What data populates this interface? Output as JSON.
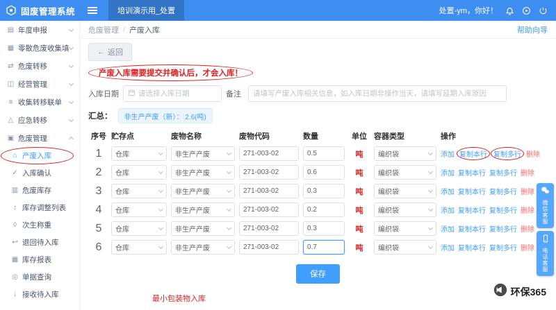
{
  "header": {
    "logo_icon": "cube-logo-icon",
    "app_title": "固废管理系统",
    "active_tab": "培训演示用_处置",
    "greeting": "处置-ym，你好！",
    "icons": [
      "bell-icon",
      "play-circle-icon",
      "power-icon"
    ]
  },
  "sidebar": {
    "items": [
      {
        "label": "年度申报",
        "icon": "calendar-icon",
        "type": "top"
      },
      {
        "label": "零散危废收集填报",
        "icon": "clipboard-icon",
        "type": "top"
      },
      {
        "label": "危废转移",
        "icon": "transfer-icon",
        "type": "top"
      },
      {
        "label": "经营管理",
        "icon": "briefcase-icon",
        "type": "top"
      },
      {
        "label": "收集转移联单",
        "icon": "list-icon",
        "type": "top"
      },
      {
        "label": "应急转移",
        "icon": "alert-icon",
        "type": "top"
      },
      {
        "label": "危废管理",
        "icon": "box-icon",
        "type": "top",
        "expanded": true
      },
      {
        "label": "产废入库",
        "icon": "warehouse-icon",
        "type": "sub",
        "active": true,
        "circled": true
      },
      {
        "label": "入库确认",
        "icon": "check-icon",
        "type": "sub"
      },
      {
        "label": "危废库存",
        "icon": "inventory-icon",
        "type": "sub"
      },
      {
        "label": "库存调整列表",
        "icon": "adjust-icon",
        "type": "sub"
      },
      {
        "label": "次生称重",
        "icon": "scale-icon",
        "type": "sub"
      },
      {
        "label": "退回待入库",
        "icon": "return-icon",
        "type": "sub"
      },
      {
        "label": "库存报表",
        "icon": "report-icon",
        "type": "sub"
      },
      {
        "label": "单据查询",
        "icon": "search-icon",
        "type": "sub"
      },
      {
        "label": "接收待入库",
        "icon": "receive-icon",
        "type": "sub"
      }
    ]
  },
  "breadcrumb": {
    "items": [
      "危废管理",
      "产废入库"
    ],
    "separator": "/",
    "help_link": "帮助向导"
  },
  "toolbar": {
    "back_icon": "←",
    "back_label": "返回"
  },
  "notice": "产废入库需要提交并确认后，才会入库！",
  "form": {
    "date_label": "入库日期",
    "date_placeholder": "请选择入库日期",
    "remark_label": "备注",
    "remark_placeholder": "请填写产废入库相关信息，如入库日期非操作当天，请填写延期入库原因"
  },
  "summary": {
    "label": "汇总：",
    "badge": "非生产产废（新）： 2.6(吨)"
  },
  "table": {
    "headers": [
      "序号",
      "贮存点",
      "废物名称",
      "废物代码",
      "数量",
      "单位",
      "容器类型",
      "操作"
    ],
    "op_labels": [
      "添加",
      "复制本行",
      "复制多行",
      "删除"
    ],
    "rows": [
      {
        "no": "1",
        "storage": "仓库",
        "waste_name": "非生产产废",
        "code": "271-003-02",
        "qty": "0.5",
        "unit": "吨",
        "container": "编织袋",
        "circle_ops": true
      },
      {
        "no": "2",
        "storage": "仓库",
        "waste_name": "非生产产废",
        "code": "271-003-02",
        "qty": "0.6",
        "unit": "吨",
        "container": "编织袋"
      },
      {
        "no": "3",
        "storage": "仓库",
        "waste_name": "非生产产废",
        "code": "271-003-02",
        "qty": "0.3",
        "unit": "吨",
        "container": "编织袋"
      },
      {
        "no": "4",
        "storage": "仓库",
        "waste_name": "非生产产废",
        "code": "271-003-02",
        "qty": "0.2",
        "unit": "吨",
        "container": "编织袋"
      },
      {
        "no": "5",
        "storage": "仓库",
        "waste_name": "非生产产废",
        "code": "271-003-02",
        "qty": "0.3",
        "unit": "吨",
        "container": "编织袋"
      },
      {
        "no": "6",
        "storage": "仓库",
        "waste_name": "非生产产废",
        "code": "271-003-02",
        "qty": "0.7",
        "unit": "吨",
        "container": "编织袋",
        "focused": true
      }
    ]
  },
  "save_button": "保存",
  "footnote": "最小包装物入库",
  "floating_buttons": [
    {
      "label": "微信客服",
      "icon": "wechat-icon"
    },
    {
      "label": "电话客服",
      "icon": "phone-icon"
    }
  ],
  "watermark": {
    "icon": "megaphone-icon",
    "text": "环保365"
  },
  "colors": {
    "primary": "#3e8ef2",
    "link": "#409eff",
    "danger": "#e02020",
    "badge_bg": "#ecf5ff"
  }
}
